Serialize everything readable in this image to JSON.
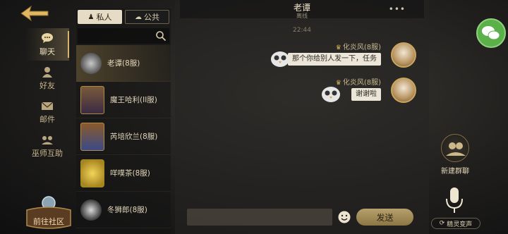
{
  "nav": {
    "items": [
      {
        "label": "聊天",
        "active": true
      },
      {
        "label": "好友",
        "active": false
      },
      {
        "label": "邮件",
        "active": false
      },
      {
        "label": "巫师互助",
        "active": false
      }
    ],
    "community_label": "前往社区"
  },
  "tabs": {
    "private": "私人",
    "public": "公共"
  },
  "contacts": [
    {
      "name": "老谭(8服)",
      "active": true
    },
    {
      "name": "魔王哈利(II服)",
      "active": false
    },
    {
      "name": "芮培欣兰(8服)",
      "active": false
    },
    {
      "name": "咩噗茶(8服)",
      "active": false
    },
    {
      "name": "冬狮郎(8服)",
      "active": false
    }
  ],
  "chat": {
    "title": "老谭",
    "status": "离线",
    "time": "22:44",
    "messages": [
      {
        "sender": "化炎风(8服)",
        "text": "那个你给别人发一下，任务"
      },
      {
        "sender": "化炎风(8服)",
        "text": "谢谢啦"
      }
    ]
  },
  "input": {
    "send_label": "发送"
  },
  "right": {
    "new_group_label": "新建群聊",
    "voice_label": "精灵变声"
  },
  "colors": {
    "accent_gold": "#d7b56d",
    "wechat_green": "#5bb04a"
  }
}
